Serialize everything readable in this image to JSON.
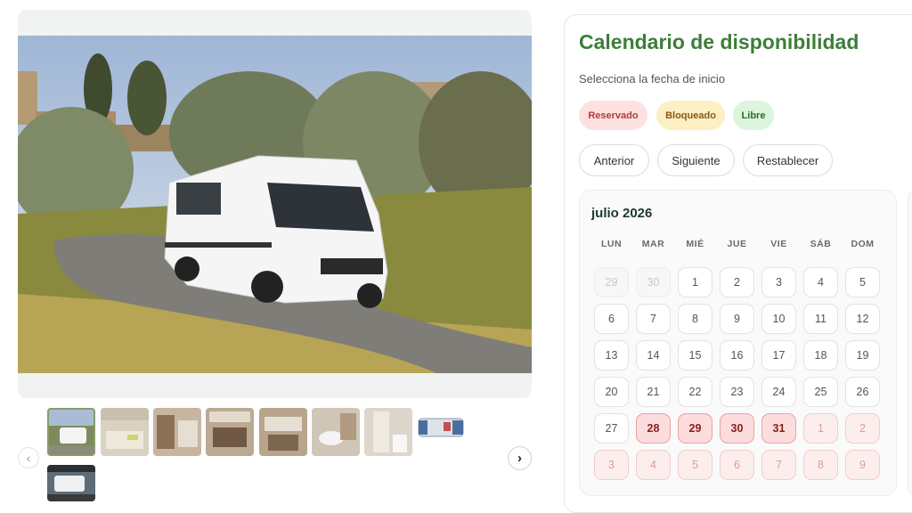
{
  "gallery": {
    "prev_icon": "‹",
    "next_icon": "›",
    "thumbnails": [
      {
        "name": "exterior-van"
      },
      {
        "name": "interior-bed"
      },
      {
        "name": "interior-kitchen"
      },
      {
        "name": "interior-lounge"
      },
      {
        "name": "interior-seating"
      },
      {
        "name": "bathroom-sink"
      },
      {
        "name": "bathroom-shower"
      },
      {
        "name": "floor-plan"
      },
      {
        "name": "exterior-awning"
      }
    ]
  },
  "calendar": {
    "title": "Calendario de disponibilidad",
    "subtitle": "Selecciona la fecha de inicio",
    "legend": {
      "reservado": "Reservado",
      "bloqueado": "Bloqueado",
      "libre": "Libre"
    },
    "buttons": {
      "prev": "Anterior",
      "next": "Siguiente",
      "reset": "Restablecer"
    },
    "month_label": "julio 2026",
    "weekdays": [
      "LUN",
      "MAR",
      "MIÉ",
      "JUE",
      "VIE",
      "SÁB",
      "DOM"
    ],
    "weeks": [
      [
        {
          "d": "29",
          "s": "muted"
        },
        {
          "d": "30",
          "s": "muted"
        },
        {
          "d": "1",
          "s": "free"
        },
        {
          "d": "2",
          "s": "free"
        },
        {
          "d": "3",
          "s": "free"
        },
        {
          "d": "4",
          "s": "free"
        },
        {
          "d": "5",
          "s": "free"
        }
      ],
      [
        {
          "d": "6",
          "s": "free"
        },
        {
          "d": "7",
          "s": "free"
        },
        {
          "d": "8",
          "s": "free"
        },
        {
          "d": "9",
          "s": "free"
        },
        {
          "d": "10",
          "s": "free"
        },
        {
          "d": "11",
          "s": "free"
        },
        {
          "d": "12",
          "s": "free"
        }
      ],
      [
        {
          "d": "13",
          "s": "free"
        },
        {
          "d": "14",
          "s": "free"
        },
        {
          "d": "15",
          "s": "free"
        },
        {
          "d": "16",
          "s": "free"
        },
        {
          "d": "17",
          "s": "free"
        },
        {
          "d": "18",
          "s": "free"
        },
        {
          "d": "19",
          "s": "free"
        }
      ],
      [
        {
          "d": "20",
          "s": "free"
        },
        {
          "d": "21",
          "s": "free"
        },
        {
          "d": "22",
          "s": "free"
        },
        {
          "d": "23",
          "s": "free"
        },
        {
          "d": "24",
          "s": "free"
        },
        {
          "d": "25",
          "s": "free"
        },
        {
          "d": "26",
          "s": "free"
        }
      ],
      [
        {
          "d": "27",
          "s": "free"
        },
        {
          "d": "28",
          "s": "reserved"
        },
        {
          "d": "29",
          "s": "reserved"
        },
        {
          "d": "30",
          "s": "reserved"
        },
        {
          "d": "31",
          "s": "reserved"
        },
        {
          "d": "1",
          "s": "reserved-light"
        },
        {
          "d": "2",
          "s": "reserved-light"
        }
      ],
      [
        {
          "d": "3",
          "s": "reserved-light"
        },
        {
          "d": "4",
          "s": "reserved-light"
        },
        {
          "d": "5",
          "s": "reserved-light"
        },
        {
          "d": "6",
          "s": "reserved-light"
        },
        {
          "d": "7",
          "s": "reserved-light"
        },
        {
          "d": "8",
          "s": "reserved-light"
        },
        {
          "d": "9",
          "s": "reserved-light"
        }
      ]
    ]
  },
  "colors": {
    "title_green": "#3f7d3a",
    "reserved_bg": "#fcdcdc",
    "blocked_bg": "#fcefc4",
    "free_bg": "#dcf5dc"
  }
}
